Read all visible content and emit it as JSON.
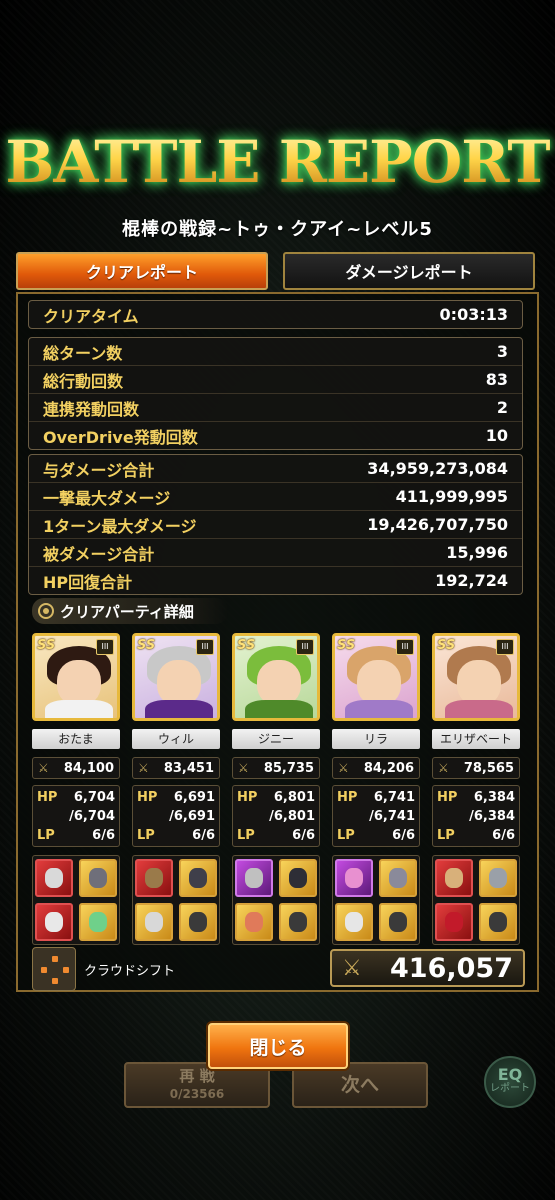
{
  "header": {
    "title": "BATTLE REPORT",
    "subtitle": "棍棒の戦録~トゥ・クアイ~レベル5"
  },
  "tabs": {
    "clear_report": "クリアレポート",
    "damage_report": "ダメージレポート"
  },
  "clear_time": {
    "label": "クリアタイム",
    "value": "0:03:13"
  },
  "turn_stats": [
    {
      "label": "総ターン数",
      "value": "3"
    },
    {
      "label": "総行動回数",
      "value": "83"
    },
    {
      "label": "連携発動回数",
      "value": "2"
    },
    {
      "label": "OverDrive発動回数",
      "value": "10"
    }
  ],
  "damage_stats": [
    {
      "label": "与ダメージ合計",
      "value": "34,959,273,084"
    },
    {
      "label": "一撃最大ダメージ",
      "value": "411,999,995"
    },
    {
      "label": "1ターン最大ダメージ",
      "value": "19,426,707,750"
    },
    {
      "label": "被ダメージ合計",
      "value": "15,996"
    },
    {
      "label": "HP回復合計",
      "value": "192,724"
    }
  ],
  "party": {
    "header": "クリアパーティ詳細",
    "hp_label": "HP",
    "lp_label": "LP",
    "members": [
      {
        "name": "おたま",
        "power": "84,100",
        "hp": "6,704",
        "hp_max": "/6,704",
        "lp": "6/6",
        "rank_badge": "III",
        "style_badge": "SS"
      },
      {
        "name": "ウィル",
        "power": "83,451",
        "hp": "6,691",
        "hp_max": "/6,691",
        "lp": "6/6",
        "rank_badge": "III",
        "style_badge": "SS"
      },
      {
        "name": "ジニー",
        "power": "85,735",
        "hp": "6,801",
        "hp_max": "/6,801",
        "lp": "6/6",
        "rank_badge": "III",
        "style_badge": "SS"
      },
      {
        "name": "リラ",
        "power": "84,206",
        "hp": "6,741",
        "hp_max": "/6,741",
        "lp": "6/6",
        "rank_badge": "III",
        "style_badge": "SS"
      },
      {
        "name": "エリザベート",
        "power": "78,565",
        "hp": "6,384",
        "hp_max": "/6,384",
        "lp": "6/6",
        "rank_badge": "III",
        "style_badge": "SS"
      }
    ]
  },
  "formation": {
    "label": "クラウドシフト"
  },
  "total_power": "416,057",
  "buttons": {
    "close": "閉じる",
    "retry": "再 戦",
    "retry_count": "0/23566",
    "next": "次へ",
    "report": "レポート",
    "report_icon": "EQ"
  },
  "colors": {
    "accent": "#f0750f",
    "label_gold": "#f2d061",
    "frame_gold": "#c9a054"
  }
}
